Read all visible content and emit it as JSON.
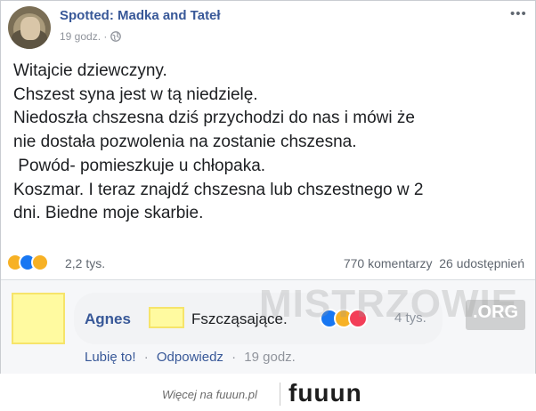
{
  "post": {
    "page_name": "Spotted: Madka and Tateł",
    "time": "19 godz. ·",
    "more_icon": "•••",
    "body_lines": [
      "Witajcie dziewczyny.",
      "Chszest syna jest w tą niedzielę.",
      "Niedoszła chszesna dziś przychodzi do nas i mówi że",
      "nie dostała pozwolenia na zostanie chszesna.",
      " Powód- pomieszkuje u chłopaka.",
      "Koszmar. I teraz znajdź chszesna lub chszestnego w 2",
      "dni. Biedne moje skarbie."
    ],
    "reactions_count": "2,2 tys.",
    "comments": "770 komentarzy",
    "shares": "26 udostępnień",
    "reaction_icons": [
      "haha-icon",
      "like-icon",
      "sad-icon"
    ]
  },
  "comment": {
    "author": "Agnes",
    "text": "Fszcząsające.",
    "reactions_count": "4 tys.",
    "reaction_icons": [
      "like-icon",
      "haha-icon",
      "love-icon"
    ],
    "like_action": "Lubię to!",
    "reply_action": "Odpowiedz",
    "separator": "·",
    "time": "19 godz."
  },
  "watermark": {
    "text": "MISTRZOWIE",
    "suffix": ".ORG"
  },
  "footer": {
    "text": "Więcej na fuuun.pl",
    "logo": "fuuun"
  },
  "colors": {
    "link_blue": "#385898",
    "like_blue": "#1877f2",
    "haha_yellow": "#f7b125",
    "love_red": "#f33e58",
    "highlight_yellow": "#fffaa0"
  }
}
